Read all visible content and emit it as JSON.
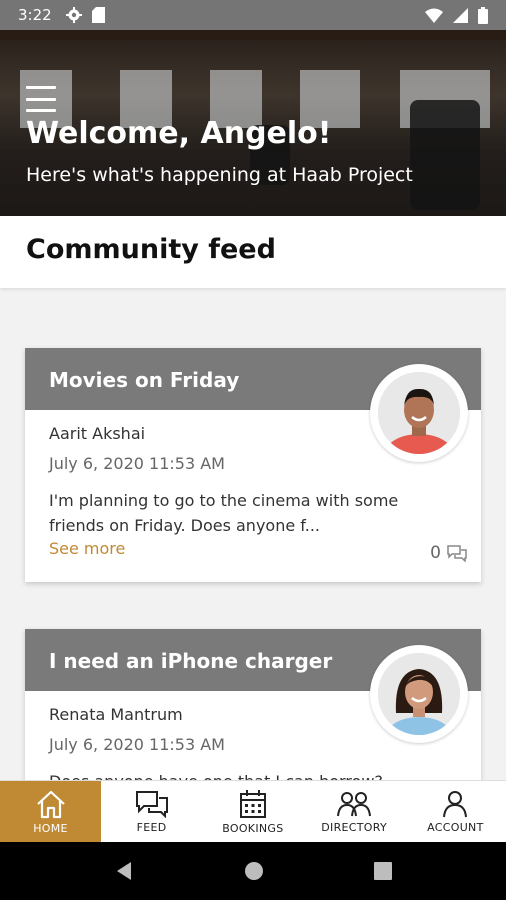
{
  "status_bar": {
    "time": "3:22"
  },
  "hero": {
    "title": "Welcome, Angelo!",
    "subtitle": "Here's what's happening at Haab Project"
  },
  "feed": {
    "heading": "Community feed",
    "posts": [
      {
        "title": "Movies on Friday",
        "author": "Aarit Akshai",
        "date": "July 6, 2020 11:53 AM",
        "body": "I'm planning to go to the cinema with some friends on Friday. Does anyone f...",
        "see_more": "See more",
        "comment_count": "0"
      },
      {
        "title": "I need an iPhone charger",
        "author": "Renata Mantrum",
        "date": "July 6, 2020 11:53 AM",
        "body": "Does anyone have one that I can borrow?"
      }
    ]
  },
  "tabs": [
    {
      "label": "HOME",
      "icon": "home-icon",
      "active": true
    },
    {
      "label": "FEED",
      "icon": "chat-icon"
    },
    {
      "label": "BOOKINGS",
      "icon": "calendar-icon"
    },
    {
      "label": "DIRECTORY",
      "icon": "people-icon"
    },
    {
      "label": "ACCOUNT",
      "icon": "person-icon"
    }
  ],
  "colors": {
    "accent": "#c08a35",
    "card_header": "#7a7a7a",
    "status_bar": "#757575"
  }
}
